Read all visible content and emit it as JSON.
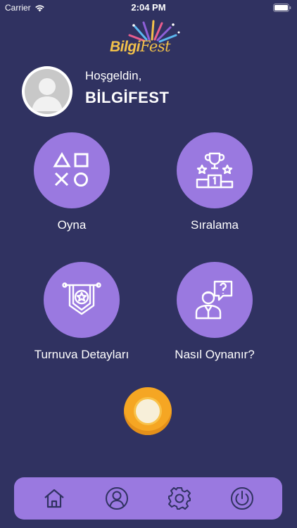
{
  "status_bar": {
    "carrier": "Carrier",
    "time": "2:04 PM"
  },
  "logo": {
    "word_1": "Bilgi",
    "word_2": "Fest"
  },
  "user": {
    "greeting": "Hoşgeldin,",
    "name": "BİLGİFEST"
  },
  "menu": [
    {
      "label": "Oyna",
      "icon": "game-symbols-icon"
    },
    {
      "label": "Sıralama",
      "icon": "podium-trophy-icon"
    },
    {
      "label": "Turnuva Detayları",
      "icon": "pennant-star-icon"
    },
    {
      "label": "Nasıl Oynanır?",
      "icon": "person-question-icon"
    }
  ],
  "tab_bar": {
    "items": [
      "home-icon",
      "profile-icon",
      "settings-icon",
      "power-icon"
    ],
    "active": "home-icon"
  },
  "colors": {
    "background": "#303261",
    "accent_purple": "#9a79e0",
    "fab_orange": "#f5a623",
    "logo_gold": "#f2c14a"
  }
}
